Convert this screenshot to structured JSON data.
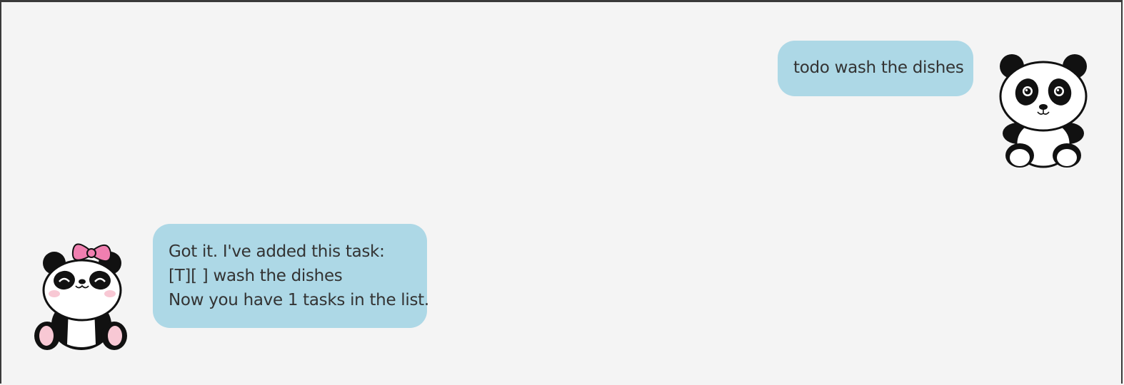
{
  "dialog": {
    "messages": [
      {
        "sender": "user",
        "avatar_icon": "panda-icon",
        "lines": [
          "todo wash the dishes"
        ]
      },
      {
        "sender": "bot",
        "avatar_icon": "panda-with-pink-bow-icon",
        "lines": [
          "Got it. I've added this task:",
          "[T][ ] wash the dishes",
          "Now you have 1 tasks in the list."
        ]
      }
    ]
  },
  "colors": {
    "background": "#f4f4f4",
    "bubble": "#add8e6",
    "text": "#333333",
    "bow": "#f07fb0",
    "blush": "#f8c8d4"
  }
}
